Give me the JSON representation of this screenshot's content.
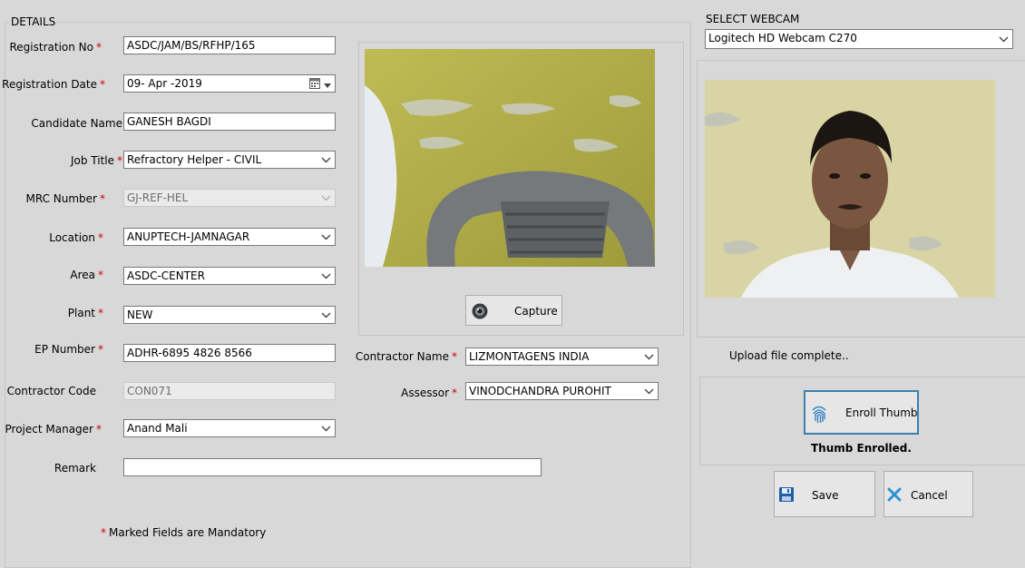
{
  "details": {
    "group_title": "DETAILS",
    "required_mark": "*",
    "fields": {
      "registration_no": {
        "label": "Registration No",
        "value": "ASDC/JAM/BS/RFHP/165"
      },
      "registration_date": {
        "label": "Registration Date",
        "value": "09- Apr -2019"
      },
      "candidate_name": {
        "label": "Candidate Name",
        "value": "GANESH BAGDI"
      },
      "job_title": {
        "label": "Job Title",
        "value": "Refractory Helper - CIVIL"
      },
      "mrc_number": {
        "label": "MRC Number",
        "value": "GJ-REF-HEL"
      },
      "location": {
        "label": "Location",
        "value": "ANUPTECH-JAMNAGAR"
      },
      "area": {
        "label": "Area",
        "value": "ASDC-CENTER"
      },
      "plant": {
        "label": "Plant",
        "value": "NEW"
      },
      "ep_number": {
        "label": "EP Number",
        "value": "ADHR-6895 4826 8566"
      },
      "contractor_code": {
        "label": "Contractor Code",
        "value": "CON071"
      },
      "project_manager": {
        "label": "Project Manager",
        "value": "Anand Mali"
      },
      "remark": {
        "label": "Remark",
        "value": ""
      },
      "contractor_name": {
        "label": "Contractor Name",
        "value": "LIZMONTAGENS INDIA"
      },
      "assessor": {
        "label": "Assessor",
        "value": "VINODCHANDRA PUROHIT"
      }
    },
    "capture_label": "Capture",
    "mandatory_note": "Marked Fields are Mandatory"
  },
  "webcam": {
    "title": "SELECT WEBCAM",
    "selected": "Logitech HD Webcam C270",
    "upload_status": "Upload file complete..",
    "enroll_label": "Enroll Thumb",
    "thumb_status": "Thumb Enrolled.",
    "save_label": "Save",
    "cancel_label": "Cancel"
  },
  "icons": {
    "required": "asterisk",
    "capture": "webcam-icon",
    "enroll": "fingerprint-icon",
    "save": "floppy-disk-icon",
    "cancel": "x-mark-icon",
    "dropdown": "chevron-down-icon",
    "calendar": "calendar-icon"
  },
  "colors": {
    "window_bg": "#d8d8d8",
    "required": "#d00000",
    "enroll_border": "#3c7fb1",
    "save_icon": "#1f5fa8",
    "cancel_icon": "#2a93d5"
  }
}
